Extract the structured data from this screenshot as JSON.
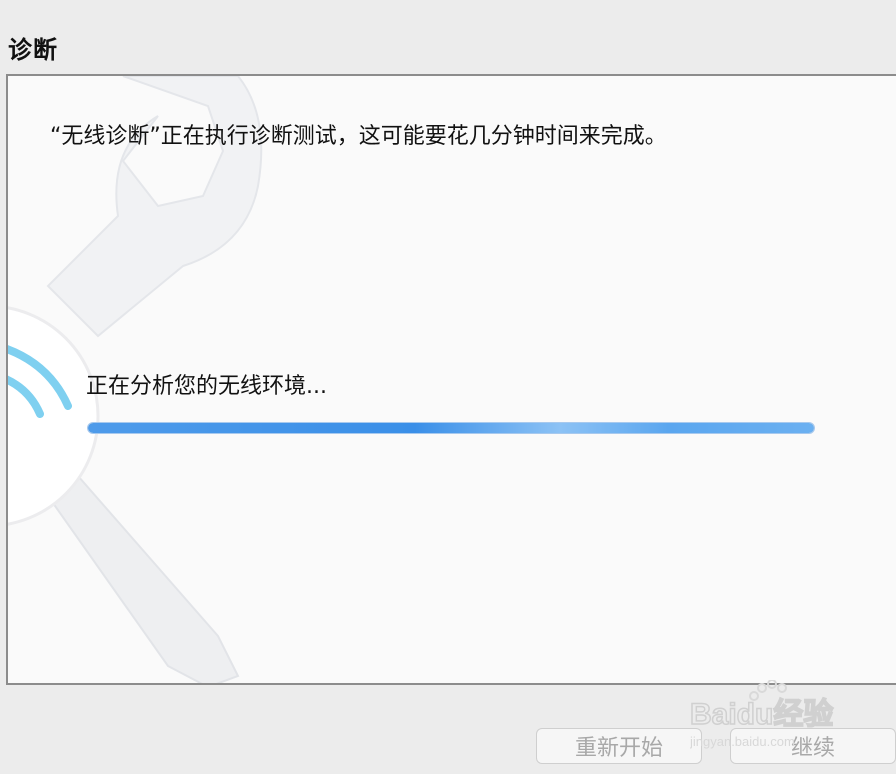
{
  "section": {
    "title": "诊断"
  },
  "panel": {
    "intro": "“无线诊断”正在执行诊断测试，这可能要花几分钟时间来完成。",
    "status": "正在分析您的无线环境...",
    "progress": 1.0
  },
  "buttons": {
    "restart_label": "重新开始",
    "continue_label": "继续"
  },
  "watermark": {
    "brand": "Baidu经验",
    "url": "jingyan.baidu.com"
  },
  "colors": {
    "progress_blue": "#3a8fe8",
    "panel_bg": "#fafafa",
    "window_bg": "#ececec"
  },
  "icons": [
    "wrench-screwdriver-wifi-art"
  ]
}
